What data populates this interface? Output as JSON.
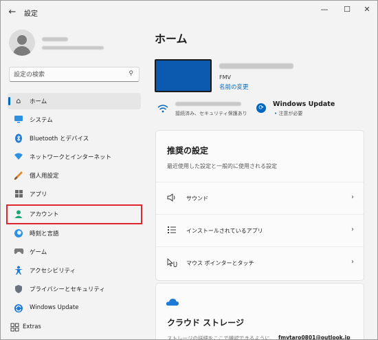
{
  "window": {
    "title": "設定"
  },
  "search": {
    "placeholder": "設定の検索"
  },
  "nav": {
    "items": [
      {
        "label": "ホーム",
        "icon": "home-icon"
      },
      {
        "label": "システム",
        "icon": "system-icon"
      },
      {
        "label": "Bluetooth とデバイス",
        "icon": "bluetooth-icon"
      },
      {
        "label": "ネットワークとインターネット",
        "icon": "network-icon"
      },
      {
        "label": "個人用設定",
        "icon": "brush-icon"
      },
      {
        "label": "アプリ",
        "icon": "apps-icon"
      },
      {
        "label": "アカウント",
        "icon": "account-icon"
      },
      {
        "label": "時刻と言語",
        "icon": "time-language-icon"
      },
      {
        "label": "ゲーム",
        "icon": "gaming-icon"
      },
      {
        "label": "アクセシビリティ",
        "icon": "accessibility-icon"
      },
      {
        "label": "プライバシーとセキュリティ",
        "icon": "shield-icon"
      },
      {
        "label": "Windows Update",
        "icon": "windows-update-icon"
      },
      {
        "label": "Extras",
        "icon": "extras-icon"
      }
    ],
    "active_index": 0,
    "highlighted_index": 6
  },
  "main": {
    "title": "ホーム",
    "device": {
      "model": "FMV",
      "rename_link": "名前の変更"
    },
    "network_status": "接続済み、セキュリティ保護あり",
    "windows_update": {
      "title": "Windows Update",
      "status": "注意が必要"
    },
    "recommended": {
      "title": "推奨の設定",
      "description": "最近使用した設定と一般的に使用される設定",
      "items": [
        {
          "label": "サウンド",
          "icon": "speaker-icon"
        },
        {
          "label": "インストールされているアプリ",
          "icon": "list-icon"
        },
        {
          "label": "マウス ポインターとタッチ",
          "icon": "pointer-icon"
        }
      ]
    },
    "cloud": {
      "title": "クラウド ストレージ",
      "description": "ストレージの詳細をここで確認できるように、",
      "email": "fmvtaro0801@outlook.jp"
    }
  },
  "colors": {
    "accent": "#0067c0",
    "highlight_border": "#e0262c",
    "device_blue": "#0b5ab0"
  }
}
